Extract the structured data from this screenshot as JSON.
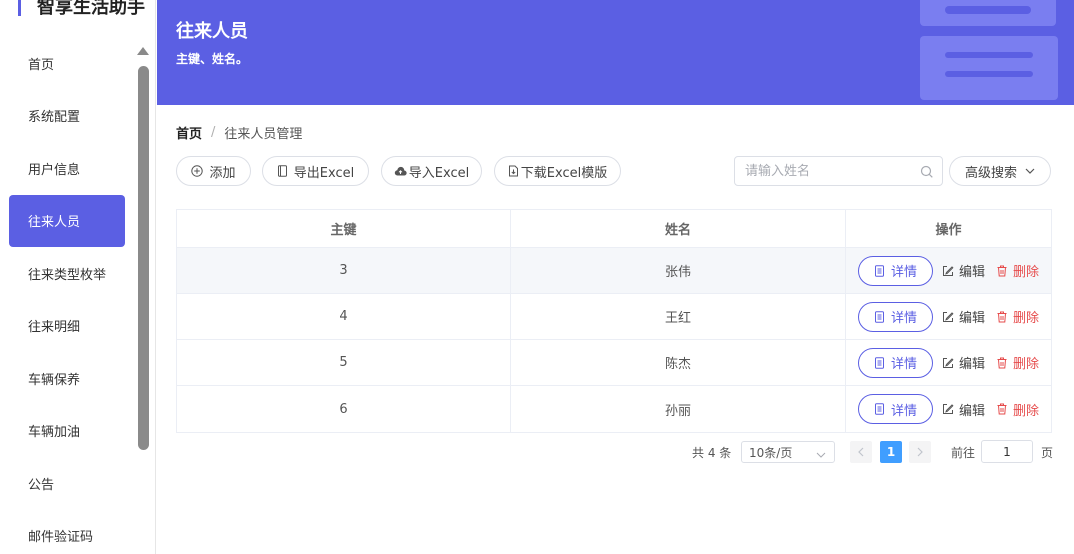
{
  "app": {
    "brand": "智享生活助手"
  },
  "sidebar": {
    "items": [
      {
        "label": "首页"
      },
      {
        "label": "系统配置"
      },
      {
        "label": "用户信息"
      },
      {
        "label": "往来人员"
      },
      {
        "label": "往来类型枚举"
      },
      {
        "label": "往来明细"
      },
      {
        "label": "车辆保养"
      },
      {
        "label": "车辆加油"
      },
      {
        "label": "公告"
      },
      {
        "label": "邮件验证码"
      }
    ],
    "active_index": 3
  },
  "banner": {
    "title": "往来人员",
    "subtitle": "主键、姓名。"
  },
  "breadcrumb": {
    "home": "首页",
    "separator": "/",
    "current": "往来人员管理"
  },
  "toolbar": {
    "add": "添加",
    "export": "导出Excel",
    "import": "导入Excel",
    "template": "下载Excel模版",
    "search_placeholder": "请输入姓名",
    "advanced": "高级搜索"
  },
  "table": {
    "headers": [
      "主键",
      "姓名",
      "操作"
    ],
    "rows": [
      {
        "id": "3",
        "name": "张伟"
      },
      {
        "id": "4",
        "name": "王红"
      },
      {
        "id": "5",
        "name": "陈杰"
      },
      {
        "id": "6",
        "name": "孙丽"
      }
    ],
    "actions": {
      "detail": "详情",
      "edit": "编辑",
      "delete": "删除"
    }
  },
  "pagination": {
    "total": "共 4 条",
    "page_size": "10条/页",
    "current_page": "1",
    "goto_label": "前往",
    "goto_value": "1",
    "page_suffix": "页"
  },
  "colors": {
    "accent": "#5b5fe3",
    "danger": "#e64b4b",
    "page_active": "#409eff"
  }
}
